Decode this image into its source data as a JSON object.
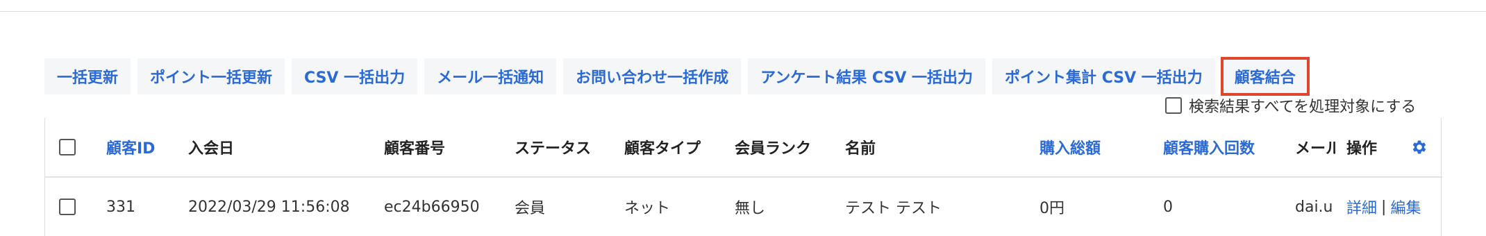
{
  "toolbar": {
    "buttons": [
      "一括更新",
      "ポイント一括更新",
      "CSV 一括出力",
      "メール一括通知",
      "お問い合わせ一括作成",
      "アンケート結果 CSV 一括出力",
      "ポイント集計 CSV 一括出力",
      "顧客結合"
    ],
    "highlighted_index": 7
  },
  "select_all": {
    "label": "検索結果すべてを処理対象にする",
    "checked": false
  },
  "table": {
    "headers": {
      "customer_id": "顧客ID",
      "join_date": "入会日",
      "customer_number": "顧客番号",
      "status": "ステータス",
      "customer_type": "顧客タイプ",
      "member_rank": "会員ランク",
      "name": "名前",
      "total_purchase": "購入総額",
      "purchase_count": "顧客購入回数",
      "email": "メール",
      "actions": "操作"
    },
    "rows": [
      {
        "customer_id": "331",
        "join_date": "2022/03/29 11:56:08",
        "customer_number": "ec24b66950",
        "status": "会員",
        "customer_type": "ネット",
        "member_rank": "無し",
        "name": "テスト テスト",
        "total_purchase": "0円",
        "purchase_count": "0",
        "email": "dai.u",
        "detail_link": "詳細",
        "separator": "|",
        "edit_link": "編集",
        "checked": false
      }
    ]
  },
  "colors": {
    "link": "#2b6ad6",
    "button_bg": "#f4f6f8",
    "highlight_border": "#e0452e"
  }
}
